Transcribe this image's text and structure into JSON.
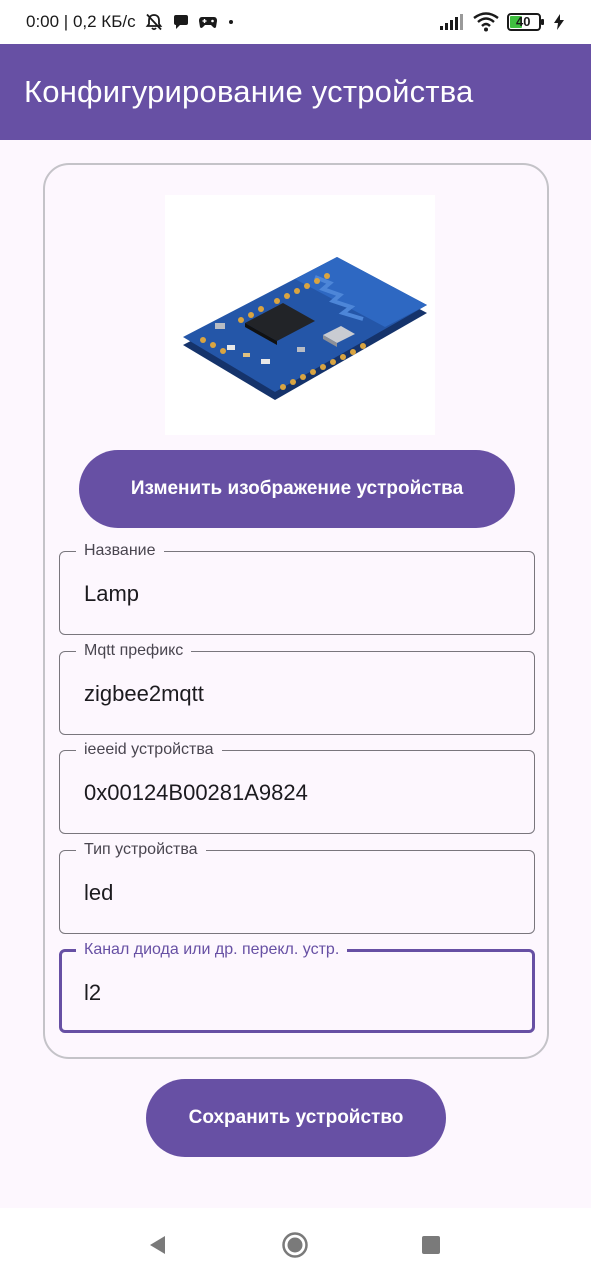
{
  "status_bar": {
    "time_and_speed": "0:00 | 0,2 КБ/с",
    "battery_level": "40"
  },
  "app_bar": {
    "title": "Конфигурирование устройства"
  },
  "card": {
    "change_image_button": "Изменить изображение устройства",
    "fields": [
      {
        "label": "Название",
        "value": "Lamp"
      },
      {
        "label": "Mqtt префикс",
        "value": "zigbee2mqtt"
      },
      {
        "label": "ieeeid устройства",
        "value": "0x00124B00281A9824"
      },
      {
        "label": "Тип устройства",
        "value": "led"
      },
      {
        "label": "Канал диода или др. перекл. устр.",
        "value": "l2"
      }
    ]
  },
  "save_button": "Сохранить устройство",
  "colors": {
    "primary": "#6750a4",
    "background": "#fdf7fe",
    "outline": "#79767d",
    "pcb_blue": "#2456a8"
  },
  "icons": {
    "status": [
      "muted-bell-icon",
      "chat-bubble-icon",
      "game-controller-icon",
      "dot-icon",
      "signal-icon",
      "wifi-icon",
      "battery-icon",
      "charging-bolt-icon"
    ],
    "nav": [
      "back-triangle-icon",
      "home-circle-icon",
      "recents-square-icon"
    ]
  }
}
